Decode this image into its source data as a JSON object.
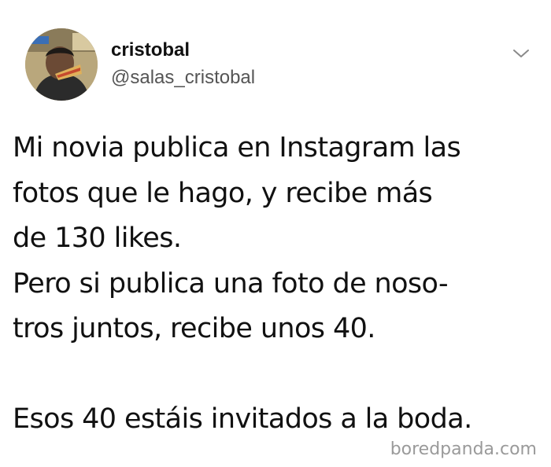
{
  "tweet": {
    "display_name": "cristobal",
    "handle": "@salas_cristobal",
    "menu_icon": "chevron-down-icon",
    "avatar_icon": "user-avatar",
    "text_lines": [
      "Mi novia publica en Instagram las",
      "fotos que le hago, y recibe más",
      "de 130 likes.",
      "Pero si publica una foto de noso-",
      "tros juntos, recibe unos 40.",
      "",
      "Esos 40 estáis invitados a la boda."
    ]
  },
  "watermark": "boredpanda.com",
  "colors": {
    "text": "#111111",
    "handle": "#555555",
    "watermark": "#9a9a9a",
    "background": "#ffffff"
  }
}
